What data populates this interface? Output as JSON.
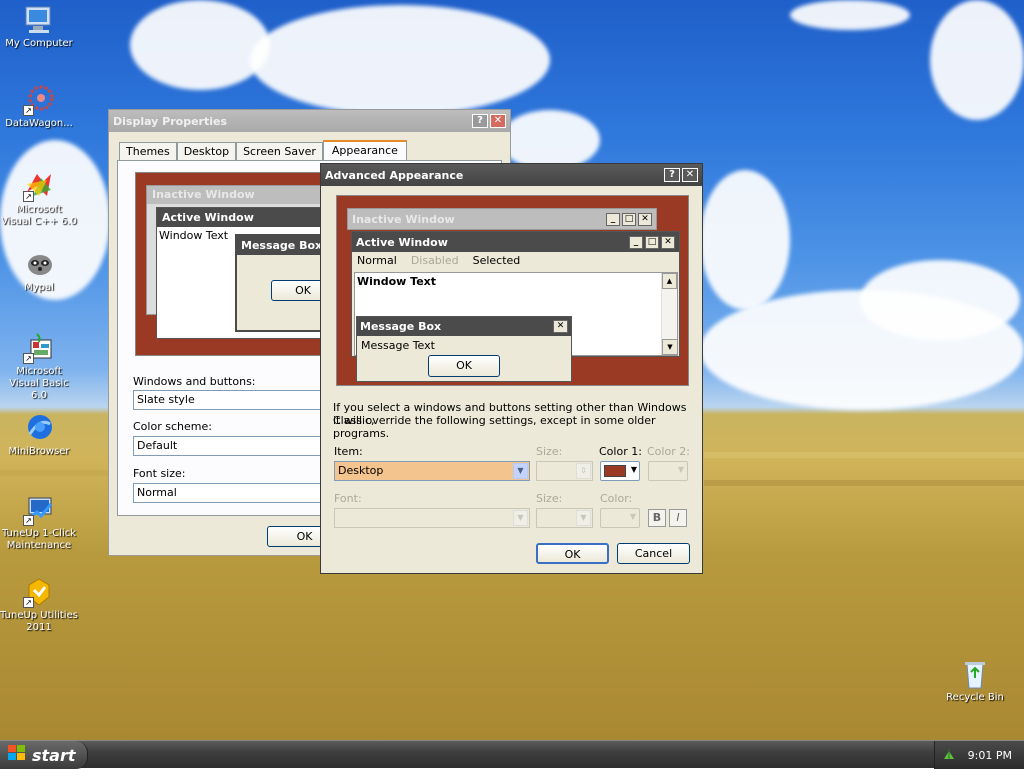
{
  "desktop_icons": [
    {
      "label": "My Computer"
    },
    {
      "label": "DataWagon..."
    },
    {
      "label": "Microsoft Visual C++ 6.0"
    },
    {
      "label": "Mypal"
    },
    {
      "label": "Microsoft Visual Basic 6.0"
    },
    {
      "label": "MiniBrowser"
    },
    {
      "label": "TuneUp 1-Click Maintenance"
    },
    {
      "label": "TuneUp Utilities 2011"
    },
    {
      "label": "Recycle Bin"
    }
  ],
  "display_props": {
    "title": "Display Properties",
    "tabs": [
      "Themes",
      "Desktop",
      "Screen Saver",
      "Appearance"
    ],
    "active_tab": "Appearance",
    "preview": {
      "inactive_title": "Inactive Window",
      "active_title": "Active Window",
      "window_text": "Window Text",
      "msgbox_title": "Message Box",
      "ok": "OK"
    },
    "windows_buttons_label": "Windows and buttons:",
    "windows_buttons_value": "Slate style",
    "color_scheme_label": "Color scheme:",
    "color_scheme_value": "Default",
    "font_size_label": "Font size:",
    "font_size_value": "Normal",
    "ok": "OK"
  },
  "advanced": {
    "title": "Advanced Appearance",
    "preview": {
      "inactive_title": "Inactive Window",
      "active_title": "Active Window",
      "menu_normal": "Normal",
      "menu_disabled": "Disabled",
      "menu_selected": "Selected",
      "window_text": "Window Text",
      "msgbox_title": "Message Box",
      "msgbox_text": "Message Text",
      "ok": "OK"
    },
    "info_line1": "If you select a windows and buttons setting other than Windows Classic,",
    "info_line2": "it will override the following settings, except in some older programs.",
    "item_label": "Item:",
    "item_value": "Desktop",
    "size_label": "Size:",
    "color1_label": "Color 1:",
    "color2_label": "Color 2:",
    "font_label": "Font:",
    "size2_label": "Size:",
    "color_label": "Color:",
    "bold": "B",
    "italic": "I",
    "ok": "OK",
    "cancel": "Cancel",
    "color1_value": "#9a3a24"
  },
  "taskbar": {
    "start": "start",
    "clock": "9:01 PM"
  },
  "colors": {
    "title_active": "#4b4b4b",
    "preview_bg": "#9a3a24",
    "item_highlight": "#f4c48f"
  }
}
